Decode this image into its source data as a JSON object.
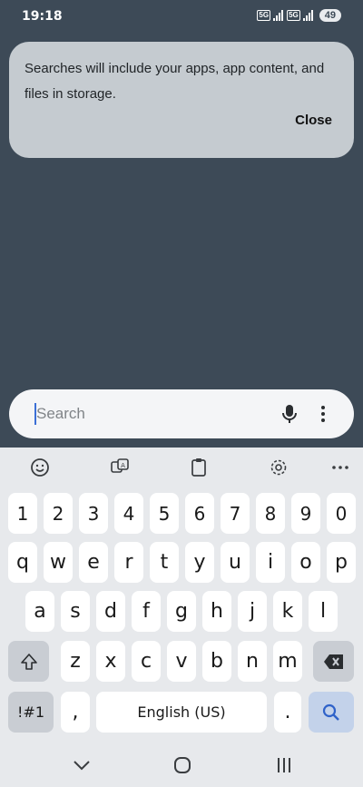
{
  "status_bar": {
    "time": "19:18",
    "badge1": "5G",
    "badge2": "5G",
    "battery": "49"
  },
  "tip": {
    "text": "Searches will include your apps, app content, and files in storage.",
    "close_label": "Close"
  },
  "search": {
    "placeholder": "Search",
    "value": ""
  },
  "keyboard": {
    "toolbar_icons": [
      "emoji-icon",
      "translate-icon",
      "clipboard-icon",
      "settings-icon",
      "more-options-icon"
    ],
    "numbers": [
      "1",
      "2",
      "3",
      "4",
      "5",
      "6",
      "7",
      "8",
      "9",
      "0"
    ],
    "row1": [
      "q",
      "w",
      "e",
      "r",
      "t",
      "y",
      "u",
      "i",
      "o",
      "p"
    ],
    "row2": [
      "a",
      "s",
      "d",
      "f",
      "g",
      "h",
      "j",
      "k",
      "l"
    ],
    "row3": [
      "z",
      "x",
      "c",
      "v",
      "b",
      "n",
      "m"
    ],
    "symbols_label": "!#1",
    "comma_label": ",",
    "space_label": "English (US)",
    "period_label": "."
  },
  "colors": {
    "background": "#3d4a57",
    "card": "#c5cbd0",
    "keyboard": "#e7e9ec",
    "accent": "#3b6fd6"
  }
}
